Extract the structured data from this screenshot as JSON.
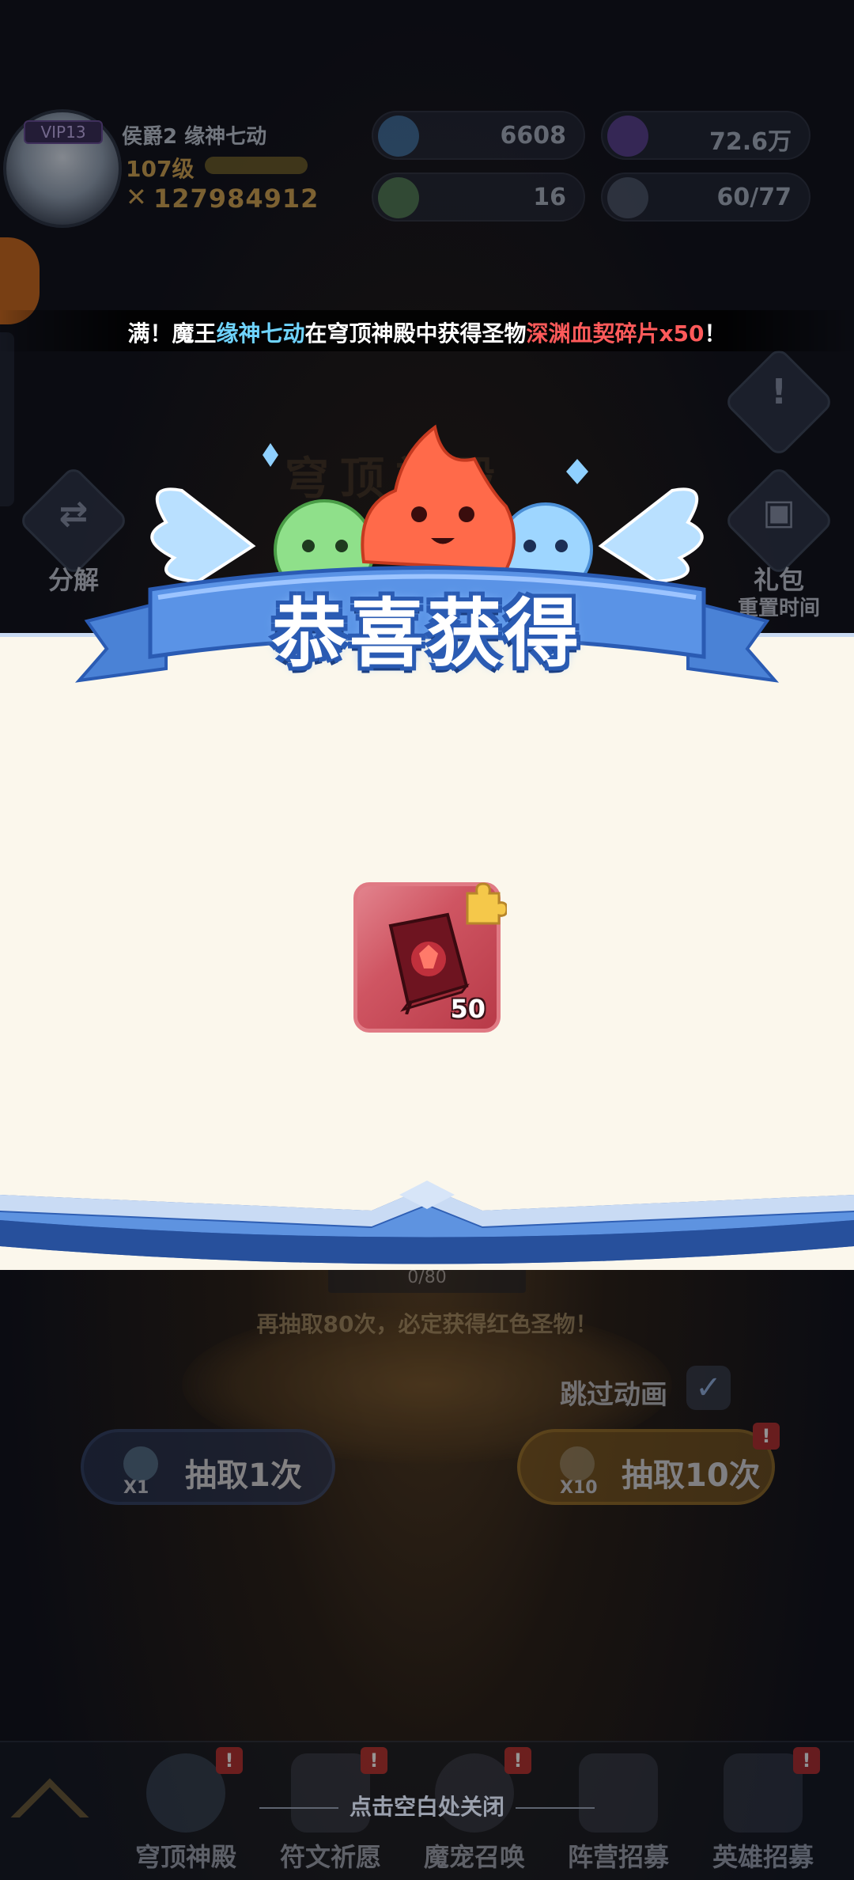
{
  "player": {
    "name": "侯爵2 缘神七动",
    "level": "107级",
    "power": "127984912",
    "vip": "VIP13"
  },
  "resources": {
    "stars": "6608",
    "gems": "72.6万",
    "tickets": "16",
    "members": "60/77"
  },
  "side_buttons": {
    "decompose": "分解",
    "gift": "礼包",
    "reset_time": "重置时间"
  },
  "temple": {
    "title": "穹顶神殿",
    "progress": "0/80",
    "pity_text": "再抽取80次，必定获得红色圣物！",
    "skip_label": "跳过动画",
    "draw_one": "抽取1次",
    "draw_one_mult": "X1",
    "draw_ten": "抽取10次",
    "draw_ten_mult": "X10"
  },
  "announcement": {
    "prefix": "满！魔王",
    "player": "缘神七动",
    "middle": "在穹顶神殿中获得圣物",
    "item": "深渊血契碎片x50",
    "suffix": "！"
  },
  "popup": {
    "title": "恭喜获得",
    "reward": {
      "icon": "abyss-blood-pact-book-icon",
      "count": "50",
      "rarity_color": "#cf5562"
    },
    "close_hint": "点击空白处关闭"
  },
  "bottom_nav": [
    {
      "label": "穹顶神殿",
      "badge": "!"
    },
    {
      "label": "符文祈愿",
      "badge": "!"
    },
    {
      "label": "魔宠召唤",
      "badge": "!"
    },
    {
      "label": "阵营招募",
      "badge": ""
    },
    {
      "label": "英雄招募",
      "badge": "!"
    }
  ],
  "colors": {
    "ribbon": "#5a93e6",
    "panel": "#fbf7ec",
    "player_name_highlight": "#6fd4ff",
    "item_highlight": "#ff5a5a"
  }
}
